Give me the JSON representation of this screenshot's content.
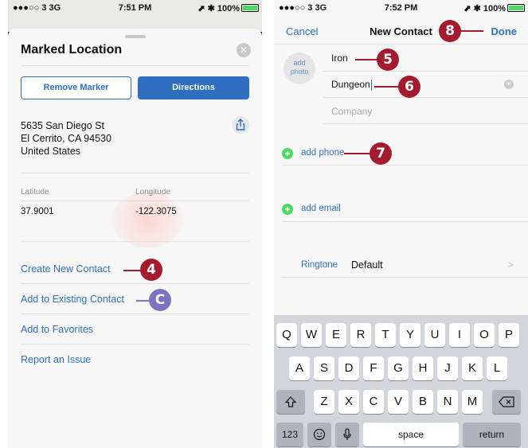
{
  "left": {
    "status": {
      "carrier": "●●●○○ 3  3G",
      "time": "7:51 PM",
      "battery": "⬈ ✱ 100%"
    },
    "card": {
      "title": "Marked Location",
      "remove_label": "Remove Marker",
      "directions_label": "Directions",
      "address": [
        "5635 San Diego St",
        "El Cerrito, CA  94530",
        "United States"
      ],
      "latitude_label": "Latitude",
      "latitude_value": "37.9001",
      "longitude_label": "Longitude",
      "longitude_value": "-122.3075",
      "links": [
        "Create New Contact",
        "Add to Existing Contact",
        "Add to Favorites",
        "Report an Issue"
      ]
    },
    "callouts": {
      "four": "4",
      "c": "C"
    }
  },
  "right": {
    "status": {
      "carrier": "●●●○○ 3  3G",
      "time": "7:52 PM",
      "battery": "⬈ ✱ 100%"
    },
    "nav": {
      "cancel": "Cancel",
      "title": "New Contact",
      "done": "Done"
    },
    "add_photo": "add photo",
    "first_name": "Iron",
    "last_name": "Dungeon",
    "company_placeholder": "Company",
    "add_phone": "add phone",
    "add_email": "add email",
    "ringtone_label": "Ringtone",
    "ringtone_value": "Default",
    "callouts": {
      "five": "5",
      "six": "6",
      "seven": "7",
      "eight": "8"
    },
    "keyboard": {
      "row1": [
        "Q",
        "W",
        "E",
        "R",
        "T",
        "Y",
        "U",
        "I",
        "O",
        "P"
      ],
      "row2": [
        "A",
        "S",
        "D",
        "F",
        "G",
        "H",
        "J",
        "K",
        "L"
      ],
      "row3": [
        "Z",
        "X",
        "C",
        "V",
        "B",
        "N",
        "M"
      ],
      "numbers": "123",
      "space": "space",
      "return": "return"
    }
  },
  "colors": {
    "accent": "#2f6fc2",
    "callout_red": "#a51b2e",
    "callout_purple": "#7d74bf",
    "add_green": "#4cd964"
  }
}
